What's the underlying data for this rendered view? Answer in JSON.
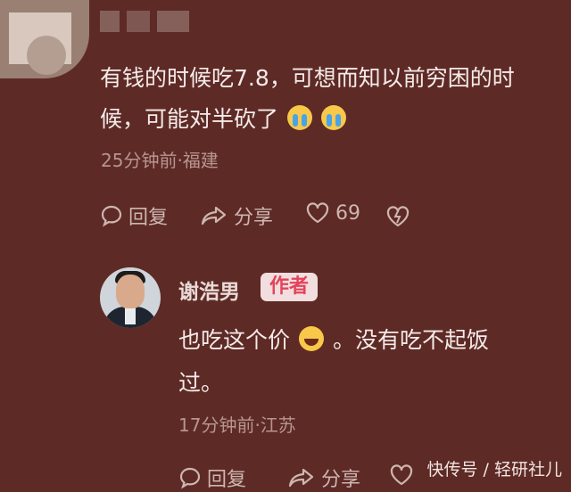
{
  "comments": [
    {
      "line1": "有钱的时候吃7.8，可想而知以前穷困的时",
      "line2": "候，可能对半砍了",
      "emojis": [
        "crying-face",
        "crying-face"
      ],
      "meta": "25分钟前·福建",
      "actions": {
        "reply": "回复",
        "share": "分享",
        "like_count": "69"
      }
    },
    {
      "author": "谢浩男",
      "badge": "作者",
      "line1_a": "也吃这个价",
      "emoji": "laughing-face",
      "line1_b": "。没有吃不起饭",
      "line2": "过。",
      "meta": "17分钟前·江苏",
      "actions": {
        "reply": "回复",
        "share": "分享",
        "like_count": ""
      }
    }
  ],
  "watermark": "快传号 / 轻研社儿",
  "colors": {
    "background": "#5e2a26",
    "badge_bg": "#f2dede",
    "badge_text": "#e3435b"
  }
}
